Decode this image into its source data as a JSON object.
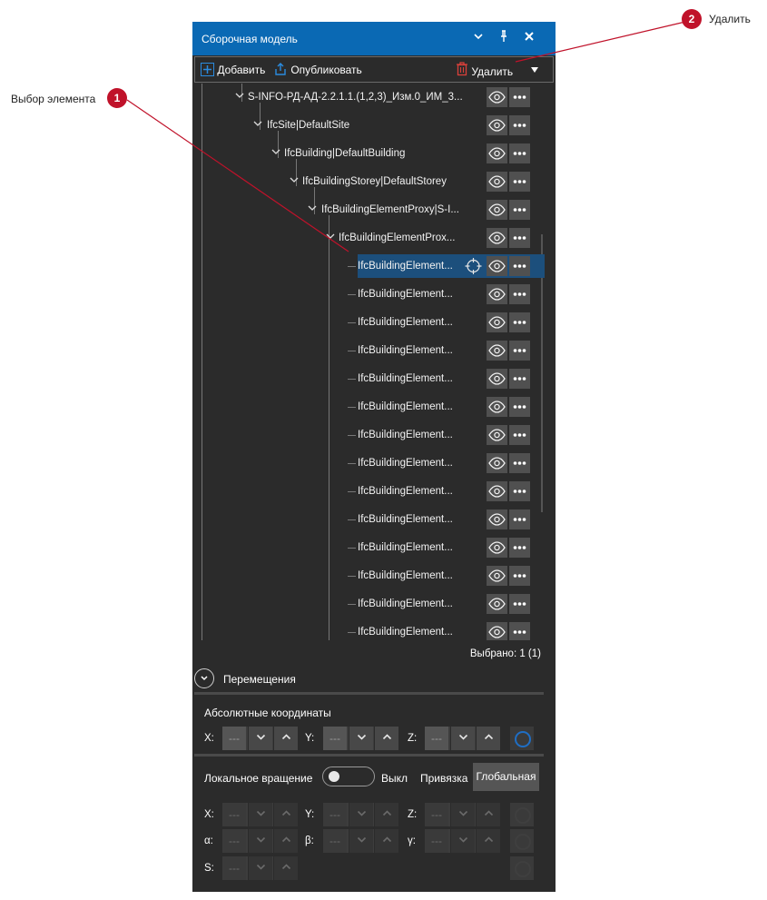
{
  "callouts": {
    "c1": {
      "num": "1",
      "text": "Выбор элемента"
    },
    "c2": {
      "num": "2",
      "text": "Удалить"
    }
  },
  "panel": {
    "title": "Сборочная модель",
    "icons": {
      "collapse": "chevron-down-icon",
      "pin": "pin-icon",
      "close": "close-icon"
    }
  },
  "toolbar": {
    "add": "Добавить",
    "publish": "Опубликовать",
    "delete": "Удалить"
  },
  "tree": {
    "nodes": [
      {
        "label": "S-INFO-РД-АД-2.2.1.1.(1,2,3)_Изм.0_ИМ_3..."
      },
      {
        "label": "IfcSite|DefaultSite"
      },
      {
        "label": "IfcBuilding|DefaultBuilding"
      },
      {
        "label": "IfcBuildingStorey|DefaultStorey"
      },
      {
        "label": "IfcBuildingElementProxy|S-I..."
      },
      {
        "label": "IfcBuildingElementProx..."
      },
      {
        "label": "IfcBuildingElement..."
      },
      {
        "label": "IfcBuildingElement..."
      },
      {
        "label": "IfcBuildingElement..."
      },
      {
        "label": "IfcBuildingElement..."
      },
      {
        "label": "IfcBuildingElement..."
      },
      {
        "label": "IfcBuildingElement..."
      },
      {
        "label": "IfcBuildingElement..."
      },
      {
        "label": "IfcBuildingElement..."
      },
      {
        "label": "IfcBuildingElement..."
      },
      {
        "label": "IfcBuildingElement..."
      },
      {
        "label": "IfcBuildingElement..."
      },
      {
        "label": "IfcBuildingElement..."
      },
      {
        "label": "IfcBuildingElement..."
      },
      {
        "label": "IfcBuildingElement..."
      }
    ],
    "selected_index": 6,
    "selected_text": "Выбрано: 1 (1)"
  },
  "movement": {
    "title": "Перемещения",
    "absolute_title": "Абсолютные координаты",
    "axes": {
      "x": "X:",
      "y": "Y:",
      "z": "Z:",
      "alpha": "α:",
      "beta": "β:",
      "gamma": "γ:",
      "s": "S:"
    },
    "placeholder": "---",
    "local_rotation": "Локальное вращение",
    "toggle_state": "Выкл",
    "binding": "Привязка",
    "binding_value": "Глобальная"
  },
  "colors": {
    "titlebar": "#0a69b4",
    "panel": "#2b2b2b",
    "selection": "#1c4f7c",
    "callout": "#c0122a"
  }
}
